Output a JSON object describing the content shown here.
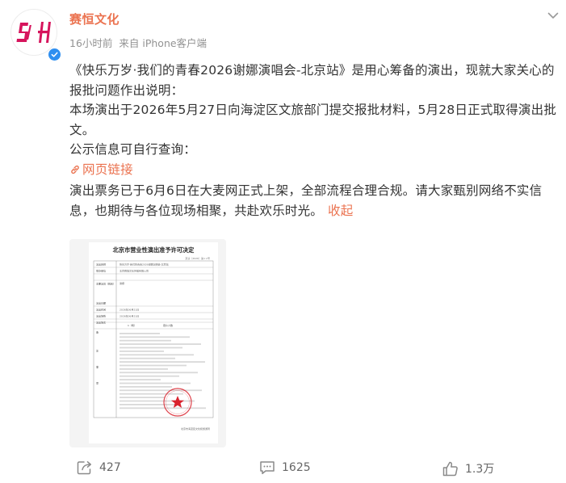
{
  "post": {
    "author": "赛恒文化",
    "avatar_text": "SH",
    "time": "16小时前",
    "source": "来自 iPhone客户端",
    "paragraphs": [
      "《快乐万岁·我们的青春2026谢娜演唱会-北京站》是用心筹备的演出，现就大家关心的报批问题作出说明：",
      "本场演出于2026年5月27日向海淀区文旅部门提交报批材料，5月28日正式取得演出批文。",
      "公示信息可自行查询："
    ],
    "link_text": "网页链接",
    "final_paragraph": "演出票务已于6月6日在大麦网正式上架，全部流程合理合规。请大家甄别网络不实信息，也期待与各位现场相聚，共赴欢乐时光。",
    "collapse_label": "收起"
  },
  "document": {
    "title": "北京市营业性演出准予许可决定",
    "doc_number": "京演〔2026〕第××号",
    "row_labels": [
      "演出名称",
      "举办单位",
      "",
      "主要演员（姓名）",
      "",
      "",
      "演出日期",
      "演出时间",
      "演出场所",
      "演出场次",
      "",
      "备",
      "注",
      "事",
      "项"
    ],
    "row_values": [
      "快乐万岁·我们的青春2026谢娜演唱会-北京站",
      "北京赛恒文化传播有限公司",
      "谢娜",
      "2026年06月21日",
      "2026年06月21日",
      "华熙LIVE·五棵松中心"
    ],
    "session_count": "1（场）",
    "audience_label": "观众人数",
    "footer": "北京市海淀区文化和旅游局"
  },
  "actions": {
    "share_count": "427",
    "comment_count": "1625",
    "like_count": "1.3万"
  },
  "colors": {
    "accent": "#eb7350",
    "verified": "#2f8ff0",
    "stamp": "#d9232e",
    "logo": "#d6145c"
  },
  "icons": [
    "more-chevron-icon",
    "verified-icon",
    "link-icon",
    "share-icon",
    "comment-icon",
    "like-icon"
  ]
}
